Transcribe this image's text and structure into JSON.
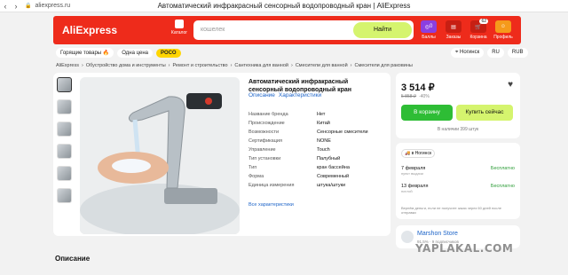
{
  "browser": {
    "url": "aliexpress.ru",
    "title": "Автоматический инфракрасный сенсорный водопроводный кран | AliExpress"
  },
  "header": {
    "logo": "AliExpress",
    "catalog": "Каталог",
    "search_placeholder": "кошелек",
    "search_button": "Найти",
    "icons": [
      {
        "label": "Баллы",
        "value": "0"
      },
      {
        "label": "Заказы",
        "value": ""
      },
      {
        "label": "Корзина",
        "value": "62"
      },
      {
        "label": "Профиль",
        "value": ""
      }
    ]
  },
  "subnav": {
    "hot": "Горящие товары",
    "one_price": "Одна цена",
    "pocket": "PОСО",
    "location": "Ногинск",
    "lang": "RU",
    "currency": "RUB"
  },
  "breadcrumbs": [
    "AliExpress",
    "Обустройство дома и инструменты",
    "Ремонт и строительство",
    "Сантехника для ванной",
    "Смесители для ванной",
    "Смесители для раковины"
  ],
  "product": {
    "title": "Автоматический инфракрасный сенсорный водопроводный кран",
    "tab_description": "Описание",
    "tab_specs": "Характеристики",
    "specs": [
      {
        "k": "Название бренда",
        "v": "Нет"
      },
      {
        "k": "Происхождение",
        "v": "Китай"
      },
      {
        "k": "Возможности",
        "v": "Сенсорные смесители"
      },
      {
        "k": "Сертификация",
        "v": "NONE"
      },
      {
        "k": "Управление",
        "v": "Touch"
      },
      {
        "k": "Тип установки",
        "v": "Палубный"
      },
      {
        "k": "Тип",
        "v": "кран бассейна"
      },
      {
        "k": "Форма",
        "v": "Современный"
      },
      {
        "k": "Единица измерения",
        "v": "штука/штуки"
      }
    ],
    "all_specs": "Все характеристики"
  },
  "buy": {
    "price": "3 514 ₽",
    "old_price": "5 858 ₽",
    "discount": "-40%",
    "cart": "В корзину",
    "buy_now": "Купить сейчас",
    "stock": "В наличии 399 штук"
  },
  "delivery": {
    "tag": "в Ногинск",
    "rows": [
      {
        "date": "7 февраля",
        "sub": "пункт выдачи",
        "price": "Бесплатно"
      },
      {
        "date": "13 февраля",
        "sub": "почтой",
        "price": "Бесплатно"
      }
    ],
    "note": "Вернём деньги, если не получите заказ через 60 дней после отправки"
  },
  "store": {
    "name": "Marshon Store",
    "meta": "91,5% · 9 подписчиков"
  },
  "section_title": "Описание",
  "watermark": "YAPLAKAL.COM",
  "colors": {
    "brand_red": "#ee2b1b",
    "accent_green": "#2ebd35",
    "accent_lime": "#d5f46e"
  }
}
